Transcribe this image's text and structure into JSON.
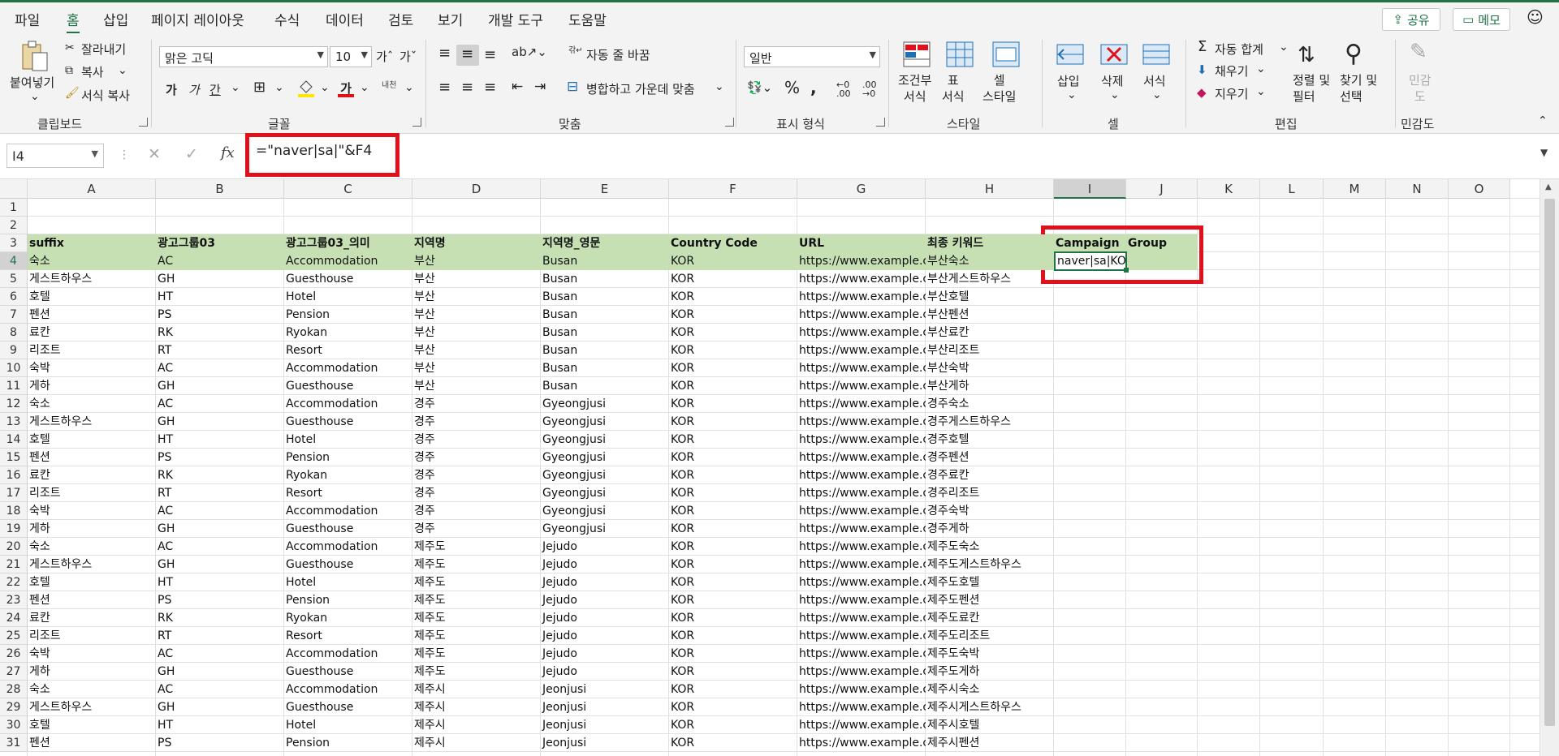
{
  "menu": [
    "파일",
    "홈",
    "삽입",
    "페이지 레이아웃",
    "수식",
    "데이터",
    "검토",
    "보기",
    "개발 도구",
    "도움말"
  ],
  "share_label": "공유",
  "memo_label": "메모",
  "ribbon": {
    "clipboard": {
      "paste": "붙여넣기",
      "cut": "잘라내기",
      "copy": "복사",
      "format_painter": "서식 복사",
      "label": "클립보드"
    },
    "font": {
      "name": "맑은 고딕",
      "size": "10",
      "bold": "가",
      "italic": "가",
      "underline": "간",
      "font_color": "가",
      "ruby": "내천",
      "label": "글꼴"
    },
    "alignment": {
      "wrap": "자동 줄 바꿈",
      "merge": "병합하고 가운데 맞춤",
      "label": "맞춤"
    },
    "number": {
      "format": "일반",
      "label": "표시 형식"
    },
    "styles": {
      "conditional": "조건부\n서식",
      "table": "표\n서식",
      "cell_style": "셀\n스타일",
      "label": "스타일"
    },
    "cells": {
      "insert": "삽입",
      "delete": "삭제",
      "format": "서식",
      "label": "셀"
    },
    "editing": {
      "autosum": "자동 합계",
      "fill": "채우기",
      "clear": "지우기",
      "sort": "정렬 및\n필터",
      "find": "찾기 및\n선택",
      "label": "편집"
    },
    "sensitivity": {
      "btn": "민감\n도",
      "label": "민감도"
    }
  },
  "namebox": "I4",
  "formula": "=\"naver|sa|\"&F4",
  "columns": [
    "A",
    "B",
    "C",
    "D",
    "E",
    "F",
    "G",
    "H",
    "I",
    "J",
    "K",
    "L",
    "M",
    "N",
    "O"
  ],
  "header_row": [
    "suffix",
    "광고그룹03",
    "광고그룹03_의미",
    "지역명",
    "지역명_영문",
    "Country Code",
    "URL",
    "최종 키워드",
    "Campaign",
    "Group"
  ],
  "url": "https://www.example.co.k",
  "active_value": "naver|sa|KOR",
  "rows": [
    [
      "숙소",
      "AC",
      "Accommodation",
      "부산",
      "Busan",
      "KOR",
      "부산숙소"
    ],
    [
      "게스트하우스",
      "GH",
      "Guesthouse",
      "부산",
      "Busan",
      "KOR",
      "부산게스트하우스"
    ],
    [
      "호텔",
      "HT",
      "Hotel",
      "부산",
      "Busan",
      "KOR",
      "부산호텔"
    ],
    [
      "펜션",
      "PS",
      "Pension",
      "부산",
      "Busan",
      "KOR",
      "부산펜션"
    ],
    [
      "료칸",
      "RK",
      "Ryokan",
      "부산",
      "Busan",
      "KOR",
      "부산료칸"
    ],
    [
      "리조트",
      "RT",
      "Resort",
      "부산",
      "Busan",
      "KOR",
      "부산리조트"
    ],
    [
      "숙박",
      "AC",
      "Accommodation",
      "부산",
      "Busan",
      "KOR",
      "부산숙박"
    ],
    [
      "게하",
      "GH",
      "Guesthouse",
      "부산",
      "Busan",
      "KOR",
      "부산게하"
    ],
    [
      "숙소",
      "AC",
      "Accommodation",
      "경주",
      "Gyeongjusi",
      "KOR",
      "경주숙소"
    ],
    [
      "게스트하우스",
      "GH",
      "Guesthouse",
      "경주",
      "Gyeongjusi",
      "KOR",
      "경주게스트하우스"
    ],
    [
      "호텔",
      "HT",
      "Hotel",
      "경주",
      "Gyeongjusi",
      "KOR",
      "경주호텔"
    ],
    [
      "펜션",
      "PS",
      "Pension",
      "경주",
      "Gyeongjusi",
      "KOR",
      "경주펜션"
    ],
    [
      "료칸",
      "RK",
      "Ryokan",
      "경주",
      "Gyeongjusi",
      "KOR",
      "경주료칸"
    ],
    [
      "리조트",
      "RT",
      "Resort",
      "경주",
      "Gyeongjusi",
      "KOR",
      "경주리조트"
    ],
    [
      "숙박",
      "AC",
      "Accommodation",
      "경주",
      "Gyeongjusi",
      "KOR",
      "경주숙박"
    ],
    [
      "게하",
      "GH",
      "Guesthouse",
      "경주",
      "Gyeongjusi",
      "KOR",
      "경주게하"
    ],
    [
      "숙소",
      "AC",
      "Accommodation",
      "제주도",
      "Jejudo",
      "KOR",
      "제주도숙소"
    ],
    [
      "게스트하우스",
      "GH",
      "Guesthouse",
      "제주도",
      "Jejudo",
      "KOR",
      "제주도게스트하우스"
    ],
    [
      "호텔",
      "HT",
      "Hotel",
      "제주도",
      "Jejudo",
      "KOR",
      "제주도호텔"
    ],
    [
      "펜션",
      "PS",
      "Pension",
      "제주도",
      "Jejudo",
      "KOR",
      "제주도펜션"
    ],
    [
      "료칸",
      "RK",
      "Ryokan",
      "제주도",
      "Jejudo",
      "KOR",
      "제주도료칸"
    ],
    [
      "리조트",
      "RT",
      "Resort",
      "제주도",
      "Jejudo",
      "KOR",
      "제주도리조트"
    ],
    [
      "숙박",
      "AC",
      "Accommodation",
      "제주도",
      "Jejudo",
      "KOR",
      "제주도숙박"
    ],
    [
      "게하",
      "GH",
      "Guesthouse",
      "제주도",
      "Jejudo",
      "KOR",
      "제주도게하"
    ],
    [
      "숙소",
      "AC",
      "Accommodation",
      "제주시",
      "Jeonjusi",
      "KOR",
      "제주시숙소"
    ],
    [
      "게스트하우스",
      "GH",
      "Guesthouse",
      "제주시",
      "Jeonjusi",
      "KOR",
      "제주시게스트하우스"
    ],
    [
      "호텔",
      "HT",
      "Hotel",
      "제주시",
      "Jeonjusi",
      "KOR",
      "제주시호텔"
    ],
    [
      "펜션",
      "PS",
      "Pension",
      "제주시",
      "Jeonjusi",
      "KOR",
      "제주시펜션"
    ]
  ]
}
